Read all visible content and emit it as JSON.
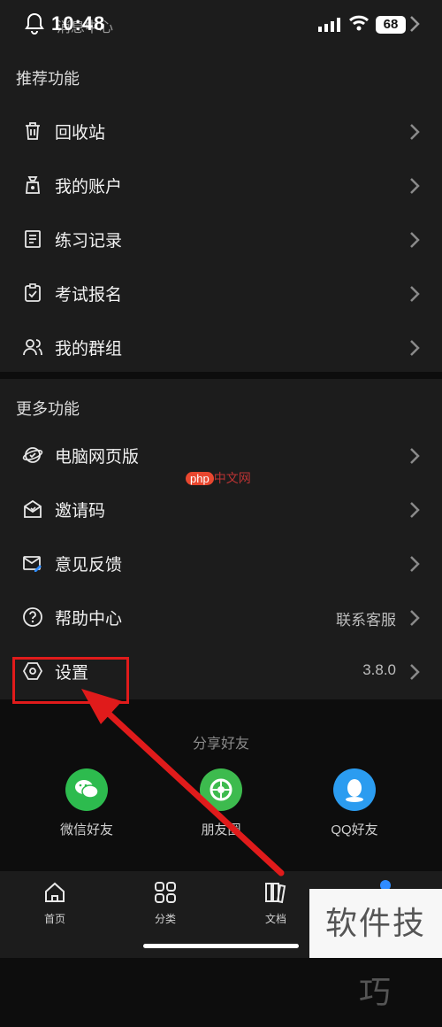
{
  "status_bar": {
    "time": "10:48",
    "overlap_text": "消息中心",
    "battery": "68"
  },
  "section_recommended": {
    "title": "推荐功能",
    "items": [
      {
        "label": "回收站",
        "icon": "trash-icon"
      },
      {
        "label": "我的账户",
        "icon": "wallet-icon"
      },
      {
        "label": "练习记录",
        "icon": "notebook-icon"
      },
      {
        "label": "考试报名",
        "icon": "clipboard-check-icon"
      },
      {
        "label": "我的群组",
        "icon": "group-icon"
      }
    ]
  },
  "section_more": {
    "title": "更多功能",
    "items": [
      {
        "label": "电脑网页版",
        "icon": "globe-icon",
        "right": ""
      },
      {
        "label": "邀请码",
        "icon": "invite-envelope-icon",
        "right": ""
      },
      {
        "label": "意见反馈",
        "icon": "feedback-mail-icon",
        "right": ""
      },
      {
        "label": "帮助中心",
        "icon": "help-circle-icon",
        "right": "联系客服"
      },
      {
        "label": "设置",
        "icon": "settings-hex-icon",
        "right": "3.8.0"
      }
    ]
  },
  "share": {
    "title": "分享好友",
    "items": [
      {
        "label": "微信好友",
        "icon": "wechat-icon",
        "color": "#2dbb4e"
      },
      {
        "label": "朋友圈",
        "icon": "moments-icon",
        "color": "#3dbb4e"
      },
      {
        "label": "QQ好友",
        "icon": "qq-icon",
        "color": "#2b9cf0"
      }
    ]
  },
  "tabs": [
    {
      "label": "首页",
      "icon": "home-icon"
    },
    {
      "label": "分类",
      "icon": "grid-icon"
    },
    {
      "label": "文档",
      "icon": "books-icon"
    }
  ],
  "watermarks": {
    "php_badge": "php",
    "php_site": "中文网",
    "corner": "软件技巧"
  },
  "colors": {
    "accent_blue": "#2f8cff",
    "highlight_red": "#e01b1b"
  }
}
